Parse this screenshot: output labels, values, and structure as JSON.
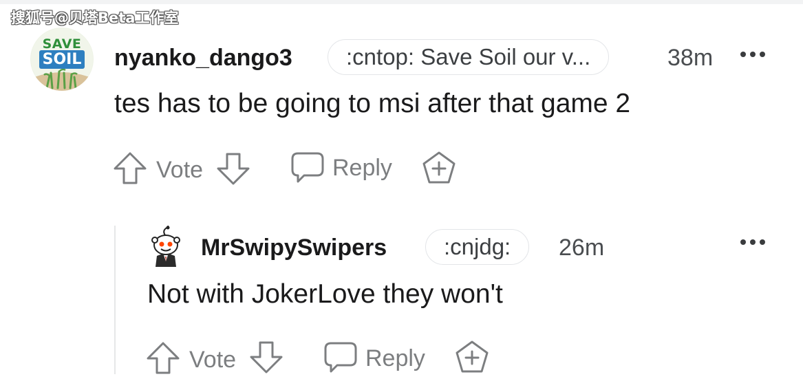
{
  "watermark": "搜狐号@贝塔Beta工作室",
  "comments": [
    {
      "avatar_text_top": "SAVE",
      "avatar_text_bottom": "SOIL",
      "username": "nyanko_dango3",
      "flair": ":cntop: Save Soil our v...",
      "time": "38m",
      "body": "tes has to be going to msi after that game 2",
      "vote_label": "Vote",
      "reply_label": "Reply",
      "icons": [
        "upvote-icon",
        "downvote-icon",
        "comment-bubble-icon",
        "award-icon",
        "more-options-icon"
      ]
    },
    {
      "username": "MrSwipySwipers",
      "flair": ":cnjdg:",
      "time": "26m",
      "body": "Not with JokerLove they won't",
      "vote_label": "Vote",
      "reply_label": "Reply",
      "icons": [
        "snoo-avatar-icon",
        "upvote-icon",
        "downvote-icon",
        "comment-bubble-icon",
        "award-icon",
        "more-options-icon"
      ]
    }
  ],
  "colors": {
    "text": "#1a1a1b",
    "muted": "#7c7e80",
    "flair_border": "#e3e5e8",
    "thread_line": "#e6e7e8",
    "save_soil_green": "#2e8b3a"
  }
}
